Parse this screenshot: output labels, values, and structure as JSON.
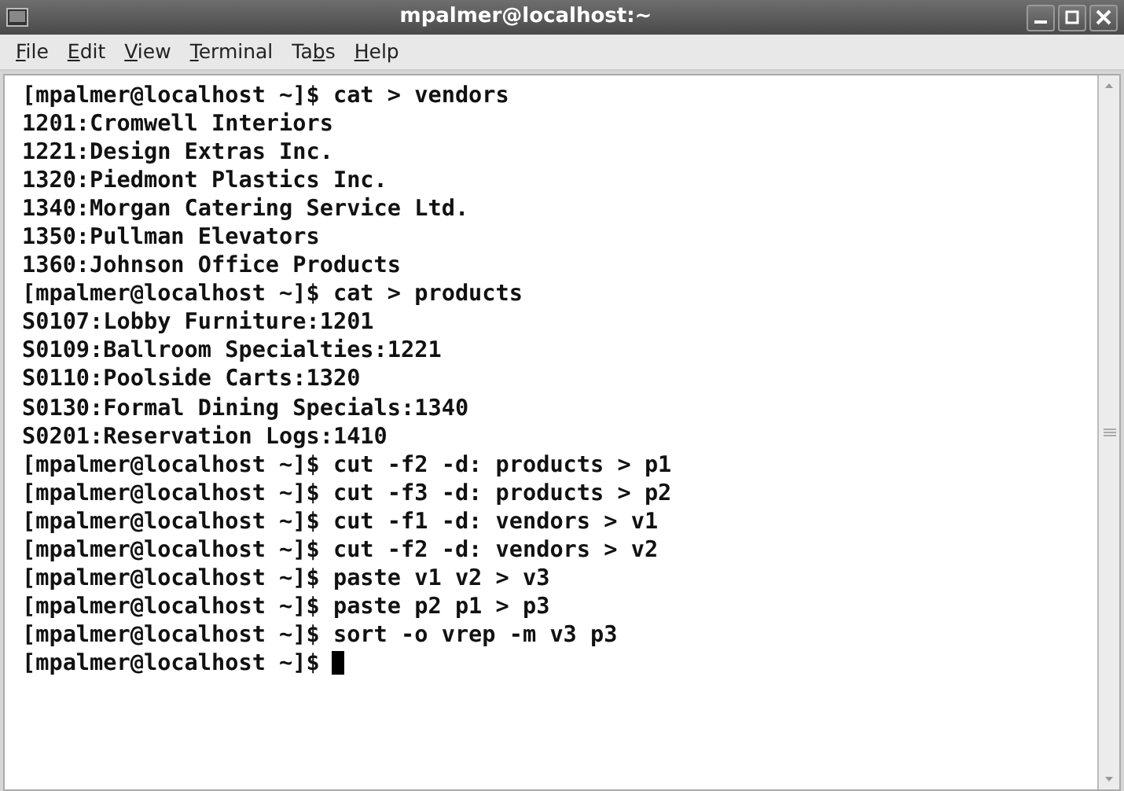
{
  "window": {
    "title": "mpalmer@localhost:~"
  },
  "menu": [
    {
      "parts": [
        {
          "text": "F",
          "underlined": true
        },
        {
          "text": "ile",
          "underlined": false
        }
      ]
    },
    {
      "parts": [
        {
          "text": "E",
          "underlined": true
        },
        {
          "text": "dit",
          "underlined": false
        }
      ]
    },
    {
      "parts": [
        {
          "text": "V",
          "underlined": true
        },
        {
          "text": "iew",
          "underlined": false
        }
      ]
    },
    {
      "parts": [
        {
          "text": "T",
          "underlined": true
        },
        {
          "text": "erminal",
          "underlined": false
        }
      ]
    },
    {
      "parts": [
        {
          "text": "Ta",
          "underlined": false
        },
        {
          "text": "b",
          "underlined": true
        },
        {
          "text": "s",
          "underlined": false
        }
      ]
    },
    {
      "parts": [
        {
          "text": "H",
          "underlined": true
        },
        {
          "text": "elp",
          "underlined": false
        }
      ]
    }
  ],
  "terminal": {
    "cursor_visible": true,
    "lines": [
      "[mpalmer@localhost ~]$ cat > vendors",
      "1201:Cromwell Interiors",
      "1221:Design Extras Inc.",
      "1320:Piedmont Plastics Inc.",
      "1340:Morgan Catering Service Ltd.",
      "1350:Pullman Elevators",
      "1360:Johnson Office Products",
      "[mpalmer@localhost ~]$ cat > products",
      "S0107:Lobby Furniture:1201",
      "S0109:Ballroom Specialties:1221",
      "S0110:Poolside Carts:1320",
      "S0130:Formal Dining Specials:1340",
      "S0201:Reservation Logs:1410",
      "[mpalmer@localhost ~]$ cut -f2 -d: products > p1",
      "[mpalmer@localhost ~]$ cut -f3 -d: products > p2",
      "[mpalmer@localhost ~]$ cut -f1 -d: vendors > v1",
      "[mpalmer@localhost ~]$ cut -f2 -d: vendors > v2",
      "[mpalmer@localhost ~]$ paste v1 v2 > v3",
      "[mpalmer@localhost ~]$ paste p2 p1 > p3",
      "[mpalmer@localhost ~]$ sort -o vrep -m v3 p3",
      "[mpalmer@localhost ~]$"
    ]
  }
}
